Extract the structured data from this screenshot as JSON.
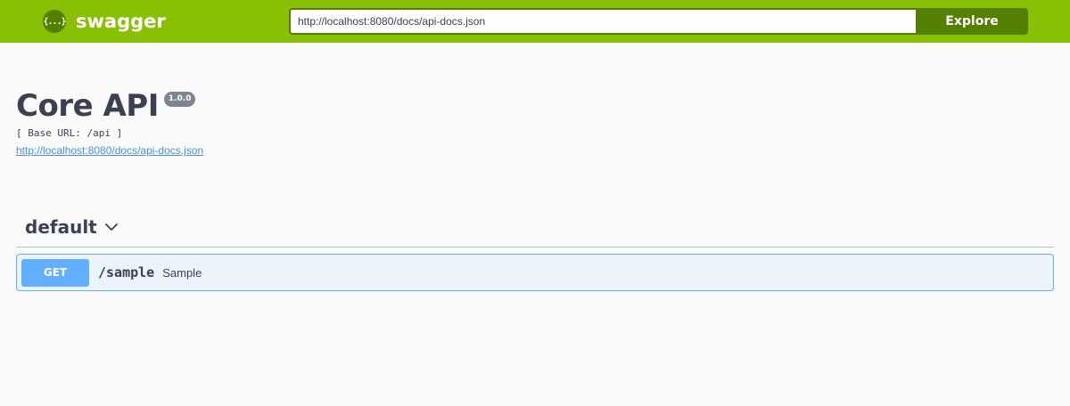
{
  "topbar": {
    "brand": "swagger",
    "logo_glyph": "{...}",
    "url_value": "http://localhost:8080/docs/api-docs.json",
    "explore_label": "Explore",
    "colors": {
      "bar": "#89bf04",
      "accent": "#547f00"
    }
  },
  "info": {
    "title": "Core API",
    "version": "1.0.0",
    "base_url": "[ Base URL: /api ]",
    "spec_link": "http://localhost:8080/docs/api-docs.json"
  },
  "tags": [
    {
      "name": "default",
      "icon": "chevron-down-icon",
      "operations": [
        {
          "method": "GET",
          "path": "/sample",
          "summary": "Sample",
          "method_color": "#61affe"
        }
      ]
    }
  ]
}
